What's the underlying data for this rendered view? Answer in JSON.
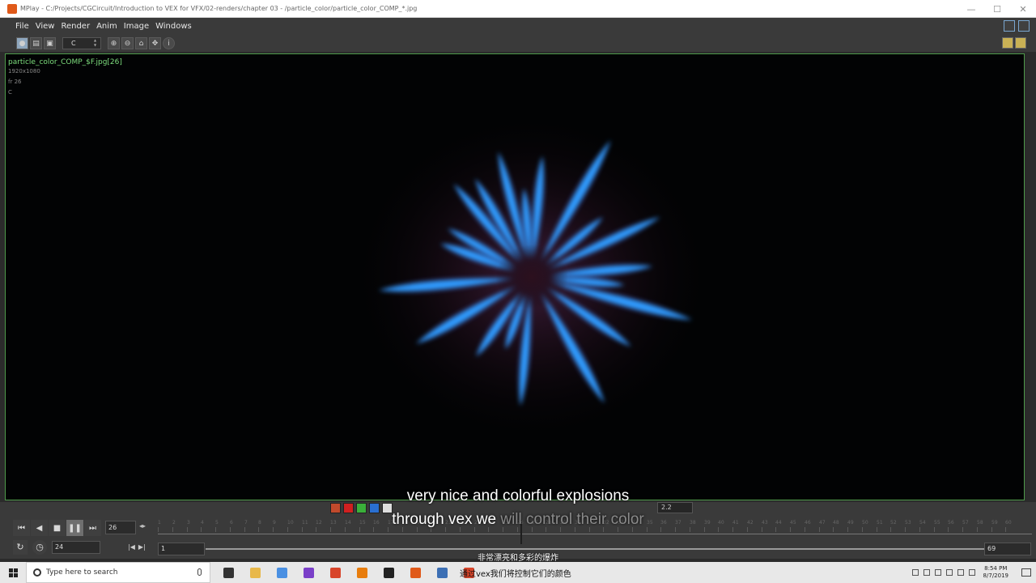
{
  "window": {
    "title": "MPlay - C:/Projects/CGCircuit/Introduction to VEX for VFX/02-renders/chapter 03 - /particle_color/particle_color_COMP_*.jpg",
    "controls": [
      "—",
      "☐",
      "✕"
    ]
  },
  "menu": [
    "File",
    "View",
    "Render",
    "Anim",
    "Image",
    "Windows"
  ],
  "toolbar": {
    "channel": "C",
    "icons": [
      "view-mode-icon",
      "compare-icon",
      "display-icon",
      "zoom-in-icon",
      "zoom-out-icon",
      "home-icon",
      "frame-icon",
      "info-icon"
    ]
  },
  "viewer": {
    "image_name": "particle_color_COMP_$F.jpg[26]",
    "resolution": "1920x1080",
    "frame_info": "fr 26",
    "channel": "C"
  },
  "color_tools": {
    "swatches": [
      "#c04a2c",
      "#d02020",
      "#3ab03a",
      "#2a6fd0",
      "#dddddd"
    ],
    "gamma": "2.2"
  },
  "playbar": {
    "current_frame": "26",
    "fps": "24",
    "range_start": "1",
    "range_end": "69",
    "ticks": [
      "1",
      "2",
      "3",
      "4",
      "5",
      "6",
      "7",
      "8",
      "9",
      "10",
      "11",
      "12",
      "13",
      "14",
      "15",
      "16",
      "17",
      "18",
      "19",
      "20",
      "21",
      "22",
      "23",
      "24",
      "25",
      "26",
      "27",
      "28",
      "29",
      "30",
      "31",
      "32",
      "33",
      "34",
      "35",
      "36",
      "37",
      "38",
      "39",
      "40",
      "41",
      "42",
      "43",
      "44",
      "45",
      "46",
      "47",
      "48",
      "49",
      "50",
      "51",
      "52",
      "53",
      "54",
      "55",
      "56",
      "57",
      "58",
      "59",
      "60"
    ]
  },
  "subtitles": {
    "line1": "very nice and colorful explosions",
    "line2_bright": "through vex we ",
    "line2_faded": "will control their color",
    "cn_line1": "非常漂亮和多彩的爆炸",
    "cn_line2": "通过vex我们将控制它们的颜色"
  },
  "taskbar": {
    "search_placeholder": "Type here to search",
    "apps": [
      {
        "name": "task-view-icon",
        "color": "#333333"
      },
      {
        "name": "file-explorer-icon",
        "color": "#e8b84a"
      },
      {
        "name": "chrome-icon",
        "color": "#4a90e2"
      },
      {
        "name": "affinity-icon",
        "color": "#7a3fc8"
      },
      {
        "name": "app-red-icon",
        "color": "#d8452a"
      },
      {
        "name": "blender-icon",
        "color": "#e87d0d"
      },
      {
        "name": "unreal-icon",
        "color": "#222222"
      },
      {
        "name": "houdini-icon",
        "color": "#e05a1a"
      },
      {
        "name": "document-icon",
        "color": "#3c6fb4"
      },
      {
        "name": "mplay-icon",
        "color": "#d8452a"
      }
    ],
    "time": "8:54 PM",
    "date": "8/7/2019"
  }
}
